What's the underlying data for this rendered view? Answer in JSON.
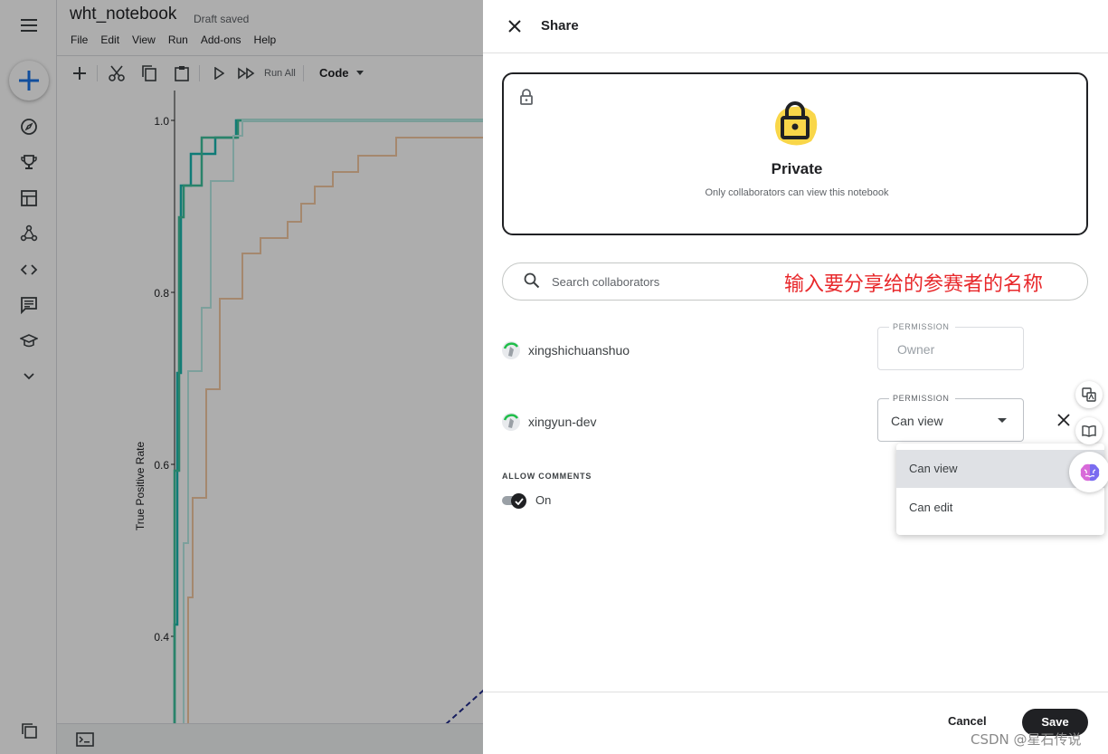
{
  "notebook": {
    "title": "wht_notebook",
    "draft_status": "Draft saved",
    "menu": [
      "File",
      "Edit",
      "View",
      "Run",
      "Add-ons",
      "Help"
    ],
    "toolbar": {
      "run_all_label": "Run All",
      "cell_type": "Code"
    }
  },
  "plot": {
    "ylabel": "True Positive Rate",
    "yticks": [
      "1.0",
      "0.8",
      "0.6",
      "0.4"
    ]
  },
  "rail": {
    "icons": [
      "menu-icon",
      "create-icon",
      "compass-icon",
      "trophy-icon",
      "table-icon",
      "models-icon",
      "code-icon",
      "discussion-icon",
      "learn-icon",
      "chevron-down-icon",
      "copy-icon"
    ]
  },
  "share": {
    "title": "Share",
    "privacy": {
      "title": "Private",
      "subtitle": "Only collaborators can view this notebook"
    },
    "search": {
      "placeholder": "Search collaborators",
      "annotation": "输入要分享给的参赛者的名称"
    },
    "collaborators": [
      {
        "name": "xingshichuanshuo",
        "permission_label": "PERMISSION",
        "permission": "Owner"
      },
      {
        "name": "xingyun-dev",
        "permission_label": "PERMISSION",
        "permission": "Can view"
      }
    ],
    "permission_options": [
      "Can view",
      "Can edit"
    ],
    "selected_option": "Can view",
    "allow_comments": {
      "label": "ALLOW COMMENTS",
      "state": "On"
    },
    "cancel_label": "Cancel",
    "save_label": "Save"
  },
  "watermark": "CSDN @星石传说",
  "colors": {
    "accent_blue": "#1a73e8",
    "lock_yellow": "#f9d649",
    "annotation_red": "#e8282b",
    "dark": "#202124"
  }
}
